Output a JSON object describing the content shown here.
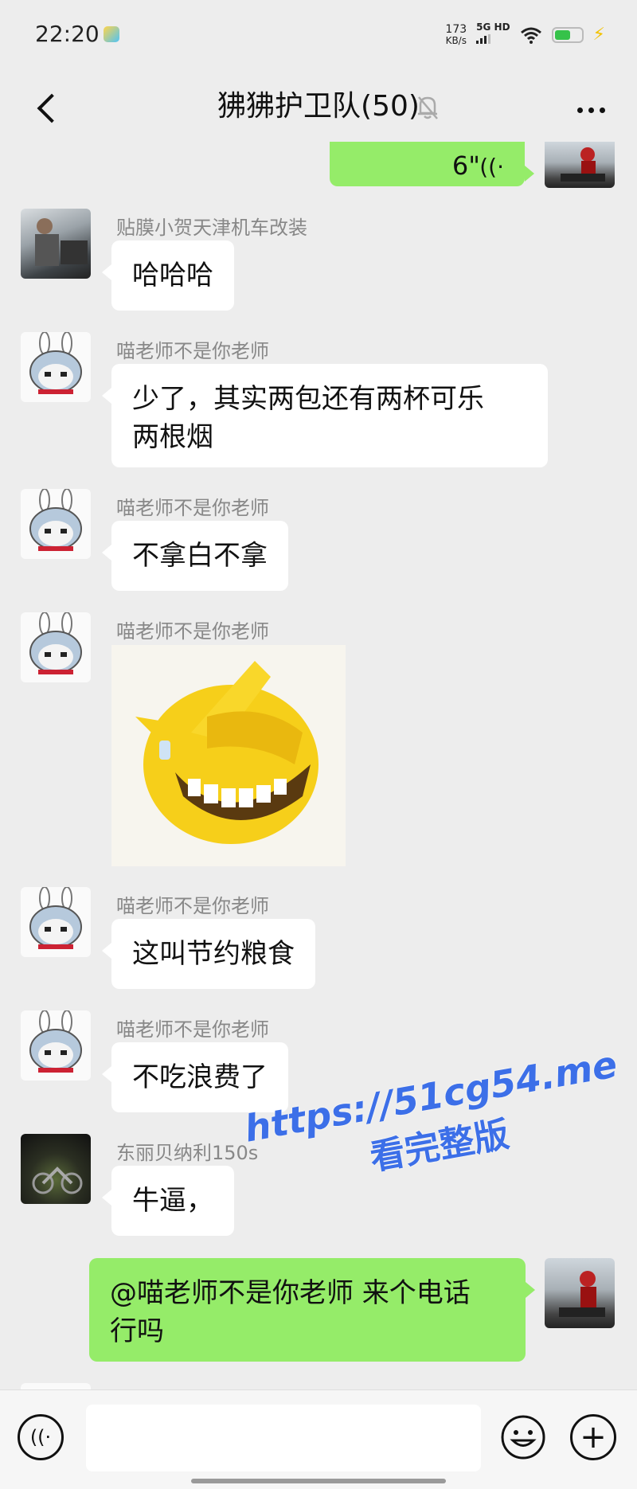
{
  "status_bar": {
    "time": "22:20",
    "net_speed_value": "173",
    "net_speed_unit": "KB/s",
    "network_type": "5G HD"
  },
  "header": {
    "title": "狒狒护卫队(50)",
    "back_icon": "chevron-left-icon",
    "mute_icon": "bell-off-icon",
    "more_icon": "more-dots-icon"
  },
  "messages": [
    {
      "from": "me",
      "type": "voice",
      "duration": "6\""
    },
    {
      "sender": "贴膜小贺天津机车改装",
      "text": "哈哈哈"
    },
    {
      "sender": "喵老师不是你老师",
      "text": "少了，其实两包还有两杯可乐\n两根烟"
    },
    {
      "sender": "喵老师不是你老师",
      "text": "不拿白不拿"
    },
    {
      "sender": "喵老师不是你老师",
      "type": "sticker",
      "sticker_icon": "laughing-emoji-sticker"
    },
    {
      "sender": "喵老师不是你老师",
      "text": "这叫节约粮食"
    },
    {
      "sender": "喵老师不是你老师",
      "text": "不吃浪费了"
    },
    {
      "sender": "东丽贝纳利150s",
      "text": "牛逼，"
    },
    {
      "from": "me",
      "text": "@喵老师不是你老师  来个电话\n行吗"
    }
  ],
  "watermark": {
    "url": "https://51cg54.me",
    "text": "看完整版"
  },
  "input_bar": {
    "value": "",
    "voice_icon": "voice-input-icon",
    "emoji_icon": "emoji-icon",
    "plus_icon": "plus-circle-icon"
  },
  "colors": {
    "background": "#ededed",
    "my_bubble": "#95ec69",
    "other_bubble": "#ffffff",
    "watermark": "#3c6fe8"
  }
}
